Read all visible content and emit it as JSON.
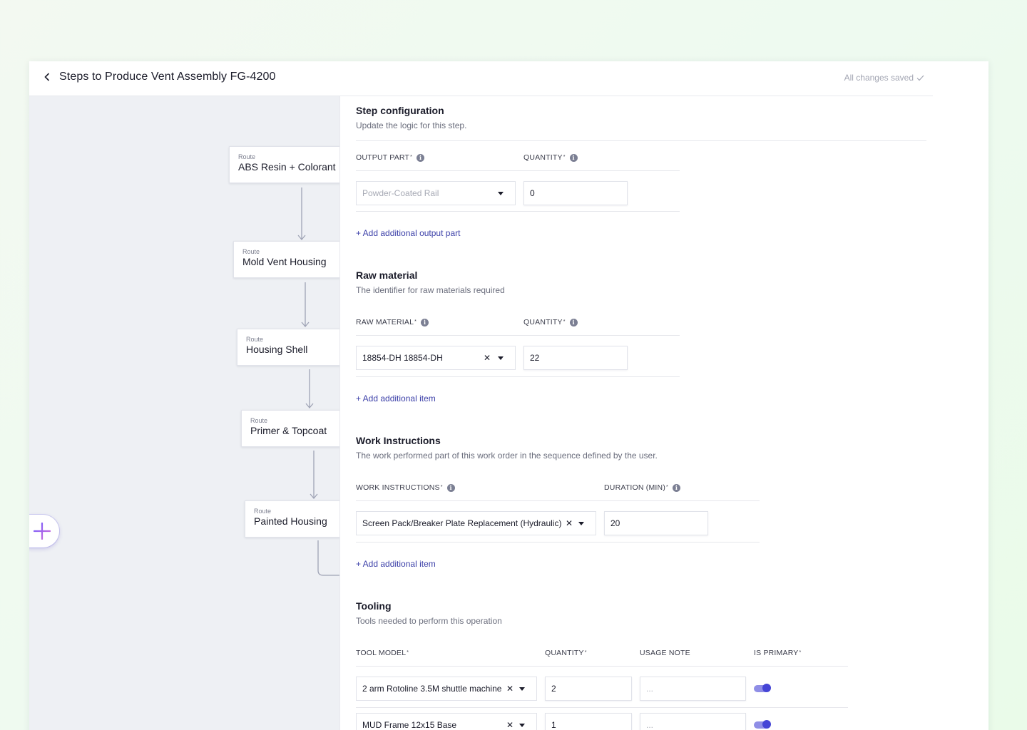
{
  "header": {
    "title": "Steps to Produce Vent Assembly FG-4200",
    "save_status": "All changes saved"
  },
  "flow": {
    "nodes": [
      {
        "kicker": "Route",
        "label": "ABS Resin + Colorant"
      },
      {
        "kicker": "Route",
        "label": "Mold Vent Housing"
      },
      {
        "kicker": "Route",
        "label": "Housing Shell"
      },
      {
        "kicker": "Route",
        "label": "Primer & Topcoat"
      },
      {
        "kicker": "Route",
        "label": "Painted Housing"
      }
    ]
  },
  "step_config": {
    "title": "Step configuration",
    "subtitle": "Update the logic for this step.",
    "output_part_label": "OUTPUT PART",
    "quantity_label": "QUANTITY",
    "output_part_value": "Powder-Coated Rail",
    "quantity_value": "0",
    "add_link": "+ Add additional output part"
  },
  "raw_material": {
    "title": "Raw material",
    "subtitle": "The identifier for raw materials required",
    "material_label": "RAW MATERIAL",
    "quantity_label": "QUANTITY",
    "material_value": "18854-DH 18854-DH",
    "quantity_value": "22",
    "add_link": "+ Add additional item"
  },
  "work_instructions": {
    "title": "Work Instructions",
    "subtitle": "The work performed part of this work order in the sequence defined by the user.",
    "instructions_label": "WORK INSTRUCTIONS",
    "duration_label": "DURATION (MIN)",
    "instructions_value": "Screen Pack/Breaker Plate Replacement (Hydraulic)",
    "duration_value": "20",
    "add_link": "+ Add additional item"
  },
  "tooling": {
    "title": "Tooling",
    "subtitle": "Tools needed to perform this operation",
    "columns": {
      "tool_model": "TOOL MODEL",
      "quantity": "QUANTITY",
      "usage_note": "USAGE NOTE",
      "is_primary": "IS PRIMARY"
    },
    "rows": [
      {
        "tool_model": "2 arm Rotoline 3.5M shuttle machine",
        "quantity": "2",
        "usage_note_placeholder": "...",
        "is_primary": true
      },
      {
        "tool_model": "MUD Frame 12x15 Base",
        "quantity": "1",
        "usage_note_placeholder": "...",
        "is_primary": true
      }
    ]
  },
  "colors": {
    "accent": "#3b3fa8",
    "toggle_on": "#4545d6",
    "canvas_bg": "#eef0f4"
  }
}
